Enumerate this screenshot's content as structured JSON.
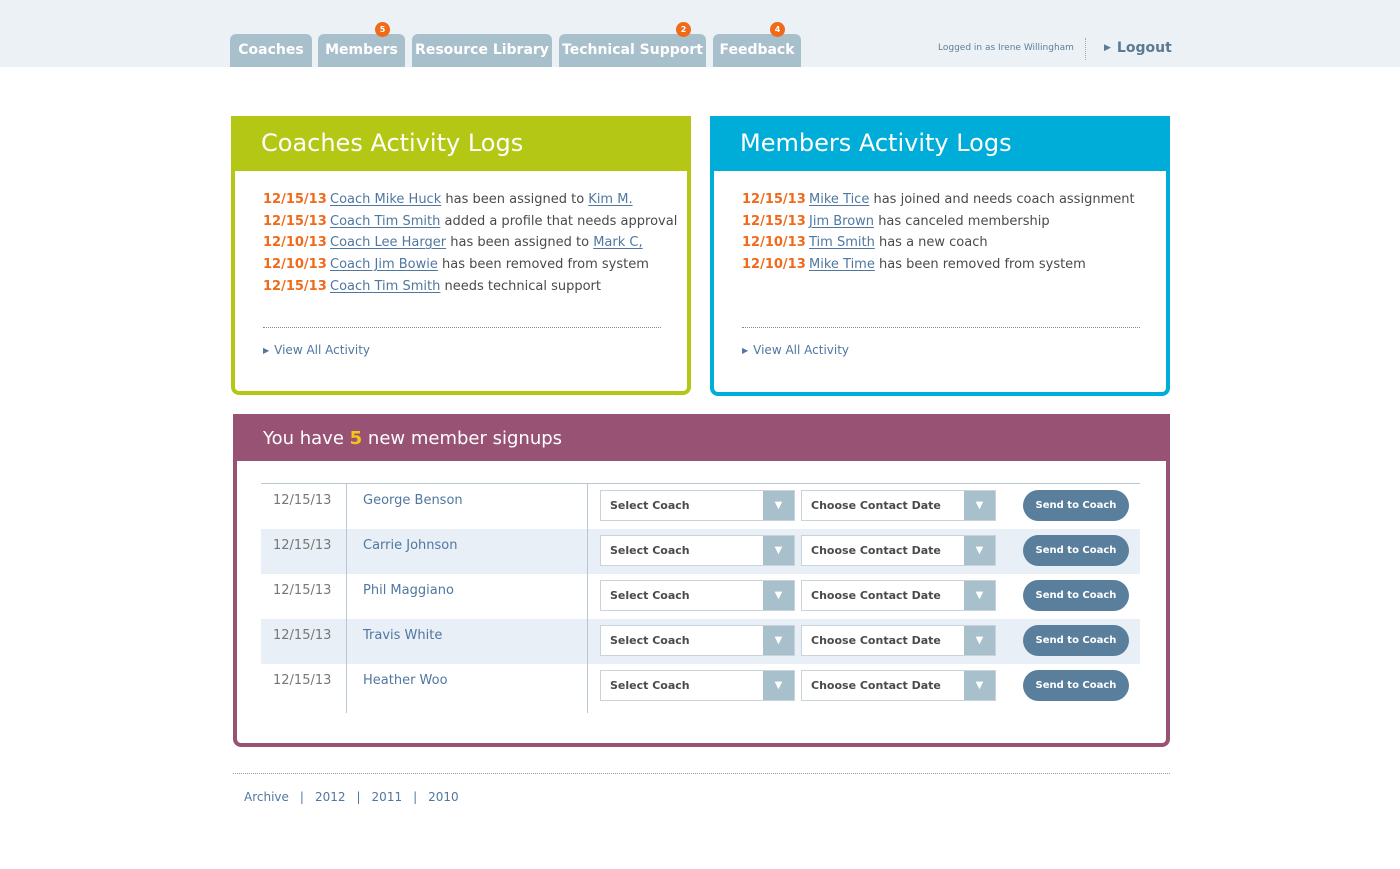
{
  "nav": {
    "tabs": [
      {
        "label": "Coaches",
        "badge": ""
      },
      {
        "label": "Members",
        "badge": "5"
      },
      {
        "label": "Resource Library",
        "badge": ""
      },
      {
        "label": "Technical Support",
        "badge": "2"
      },
      {
        "label": "Feedback",
        "badge": "4"
      }
    ],
    "logged_in": "Logged in as Irene Willingham",
    "logout": "Logout"
  },
  "coaches_panel": {
    "title": "Coaches Activity Logs",
    "entries": [
      {
        "date": "12/15/13",
        "link1": "Coach Mike Huck",
        "text": "has been assigned to",
        "link2": "Kim M."
      },
      {
        "date": "12/15/13",
        "link1": "Coach Tim Smith",
        "text": "added a profile that needs approval",
        "link2": ""
      },
      {
        "date": "12/10/13",
        "link1": "Coach Lee Harger",
        "text": "has been assigned to",
        "link2": "Mark C,"
      },
      {
        "date": "12/10/13",
        "link1": "Coach Jim Bowie",
        "text": "has been removed from system",
        "link2": ""
      },
      {
        "date": "12/15/13",
        "link1": "Coach Tim Smith",
        "text": "needs technical support",
        "link2": ""
      }
    ],
    "view_all": "View All Activity"
  },
  "members_panel": {
    "title": "Members Activity Logs",
    "entries": [
      {
        "date": "12/15/13",
        "link1": "Mike Tice",
        "text": "has joined and needs coach assignment"
      },
      {
        "date": "12/15/13",
        "link1": "Jim Brown",
        "text": "has canceled membership"
      },
      {
        "date": "12/10/13",
        "link1": "Tim Smith",
        "text": "has a new coach"
      },
      {
        "date": "12/10/13",
        "link1": "Mike Time",
        "text": "has been removed from system"
      }
    ],
    "view_all": "View All Activity"
  },
  "signups": {
    "prefix": "You have",
    "count": "5",
    "suffix": "new member signups",
    "select_coach": "Select Coach",
    "choose_date": "Choose Contact Date",
    "send_label": "Send to Coach",
    "rows": [
      {
        "date": "12/15/13",
        "name": "George Benson"
      },
      {
        "date": "12/15/13",
        "name": "Carrie Johnson"
      },
      {
        "date": "12/15/13",
        "name": "Phil Maggiano"
      },
      {
        "date": "12/15/13",
        "name": "Travis White"
      },
      {
        "date": "12/15/13",
        "name": "Heather Woo"
      }
    ]
  },
  "footer": {
    "links": [
      "Archive",
      "2012",
      "2011",
      "2010"
    ]
  },
  "colors": {
    "coaches_accent": "#b3c714",
    "members_accent": "#00acd8",
    "signups_accent": "#985374",
    "date_orange": "#f06a1a",
    "badge": "#f06a1a"
  }
}
